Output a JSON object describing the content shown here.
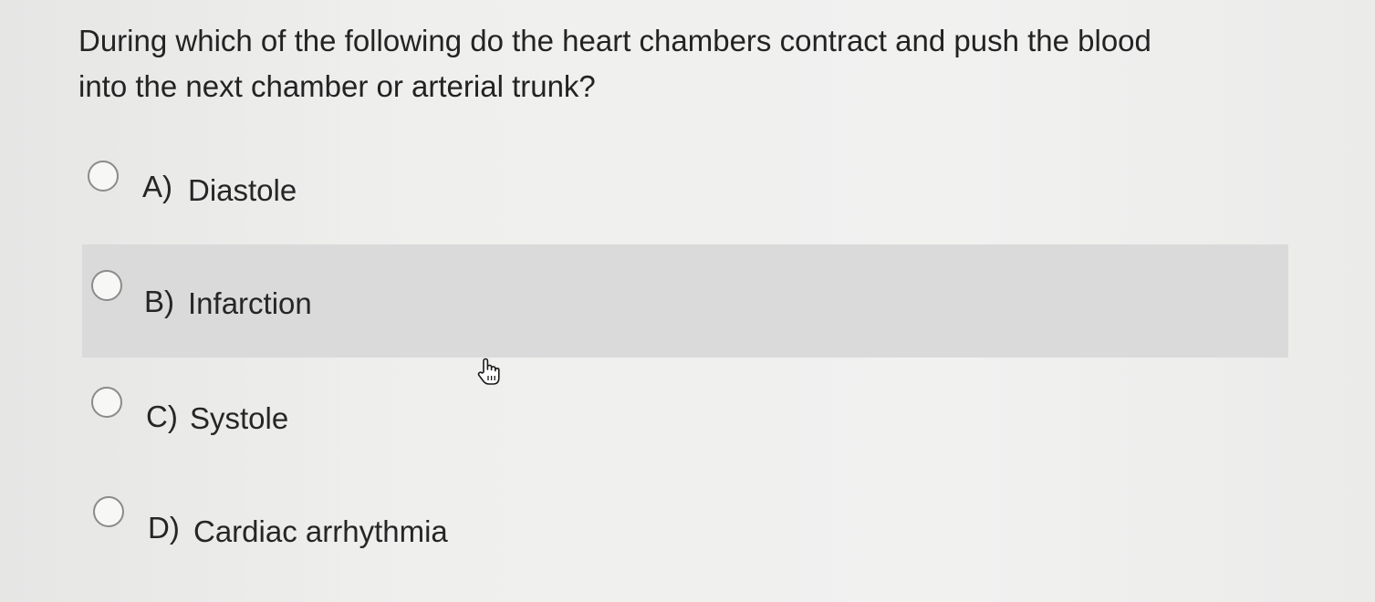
{
  "question": {
    "text_line1": "During which of the following do the heart chambers contract and push the blood",
    "text_line2": "into the next chamber or arterial trunk?"
  },
  "options": [
    {
      "letter": "A)",
      "label": "Diastole",
      "selected": false,
      "hovered": false
    },
    {
      "letter": "B)",
      "label": "Infarction",
      "selected": false,
      "hovered": true
    },
    {
      "letter": "C)",
      "label": "Systole",
      "selected": false,
      "hovered": false
    },
    {
      "letter": "D)",
      "label": "Cardiac arrhythmia",
      "selected": false,
      "hovered": false
    }
  ],
  "cursor": {
    "icon": "hand-pointer-icon"
  },
  "colors": {
    "hover_row": "#dadada",
    "background": "#efefee",
    "radio_border": "#8b8b8b"
  }
}
